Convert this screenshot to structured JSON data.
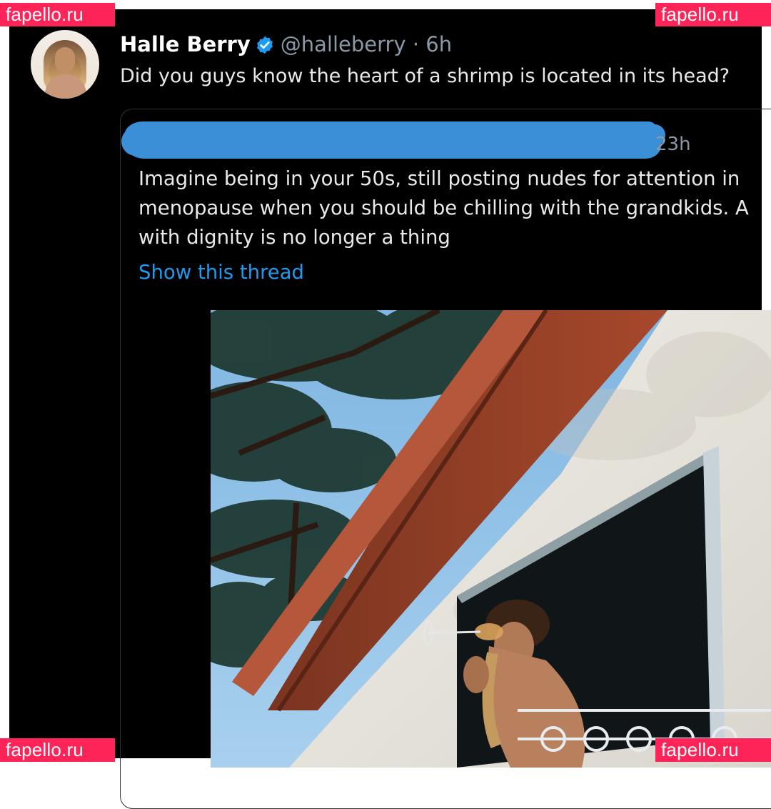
{
  "watermark": {
    "text": "fapello.ru"
  },
  "tweet": {
    "author_name": "Halle Berry",
    "handle": "@halleberry",
    "separator": "·",
    "time": "6h",
    "text": "Did you guys know the heart of a shrimp is located in its head?",
    "avatar_icon": "avatar-photo"
  },
  "quoted_tweet": {
    "author": "",
    "time": "23h",
    "lines": [
      "Imagine being in your 50s, still posting nudes for attention in",
      "menopause when you should be chilling with the grandkids. A",
      "with dignity is no longer a thing"
    ],
    "show_thread": "Show this thread",
    "image": "photo-woman-at-window"
  },
  "colors": {
    "background": "#000000",
    "text": "#e7e9ea",
    "secondary_text": "#8b98a5",
    "link": "#1d9bf0",
    "verified": "#1d9bf0",
    "redaction": "#3a8fd6",
    "watermark_bg": "#ff2458"
  }
}
